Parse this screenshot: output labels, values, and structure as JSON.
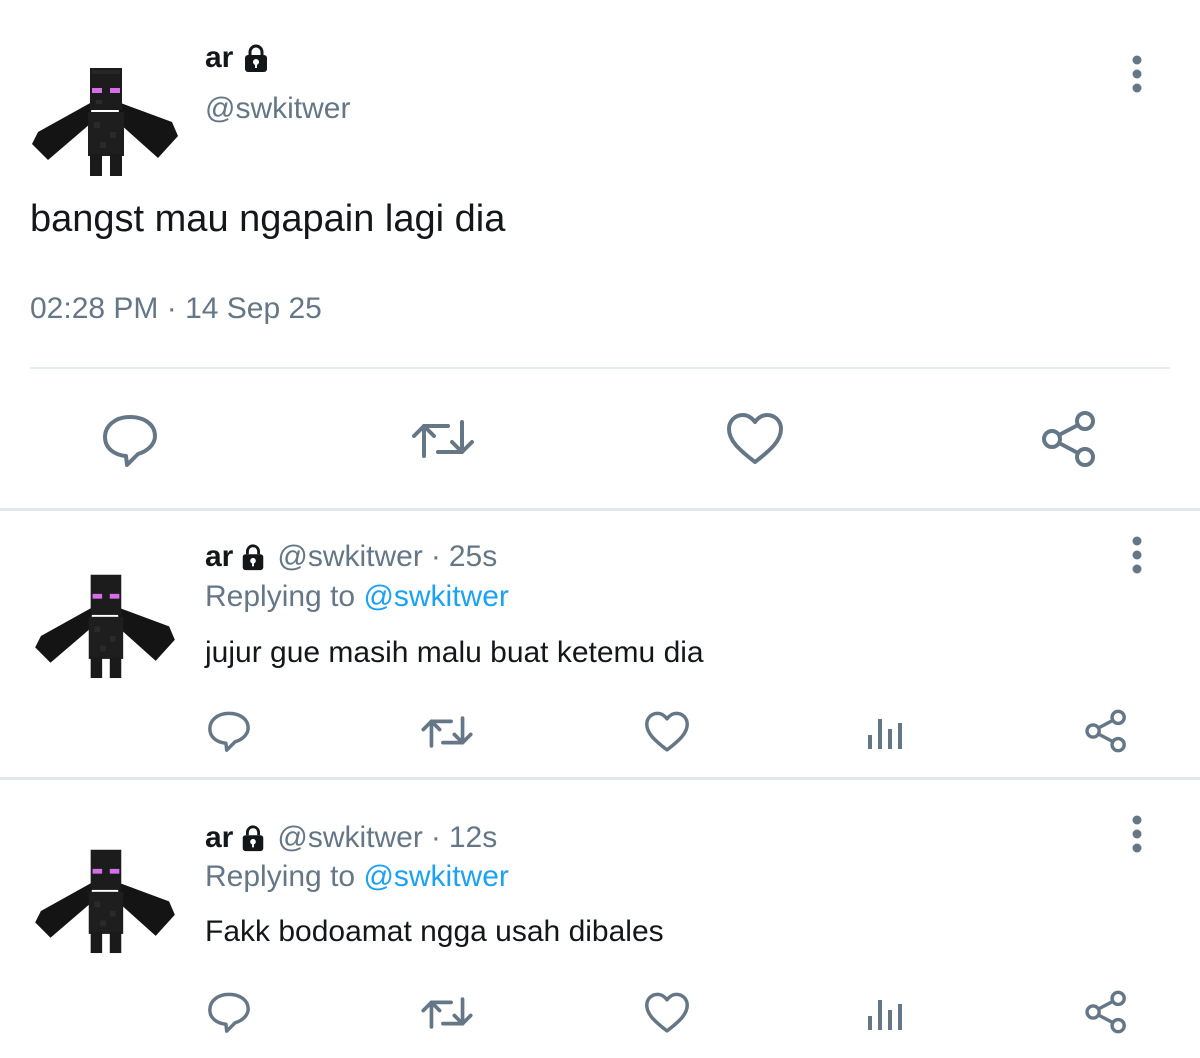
{
  "main_tweet": {
    "name": "ar",
    "handle": "@swkitwer",
    "text": "bangst mau ngapain lagi dia",
    "timestamp": "02:28 PM · 14 Sep 25",
    "icons": {
      "lock": "lock-icon",
      "more": "more-vertical-icon",
      "reply": "reply-icon",
      "retweet": "retweet-icon",
      "like": "heart-icon",
      "share": "share-icon"
    }
  },
  "replies": [
    {
      "name": "ar",
      "handle": "@swkitwer",
      "separator": "·",
      "time": "25s",
      "replying_prefix": "Replying to",
      "replying_mention": "@swkitwer",
      "text": "jujur gue masih malu buat ketemu dia"
    },
    {
      "name": "ar",
      "handle": "@swkitwer",
      "separator": "·",
      "time": "12s",
      "replying_prefix": "Replying to",
      "replying_mention": "@swkitwer",
      "text": "Fakk bodoamat ngga usah dibales"
    }
  ],
  "colors": {
    "text_primary": "#14171a",
    "text_secondary": "#657786",
    "link": "#1da1f2",
    "icon": "#657786",
    "divider": "#e6ecf0",
    "avatar_eyes": "#d66ee8"
  }
}
